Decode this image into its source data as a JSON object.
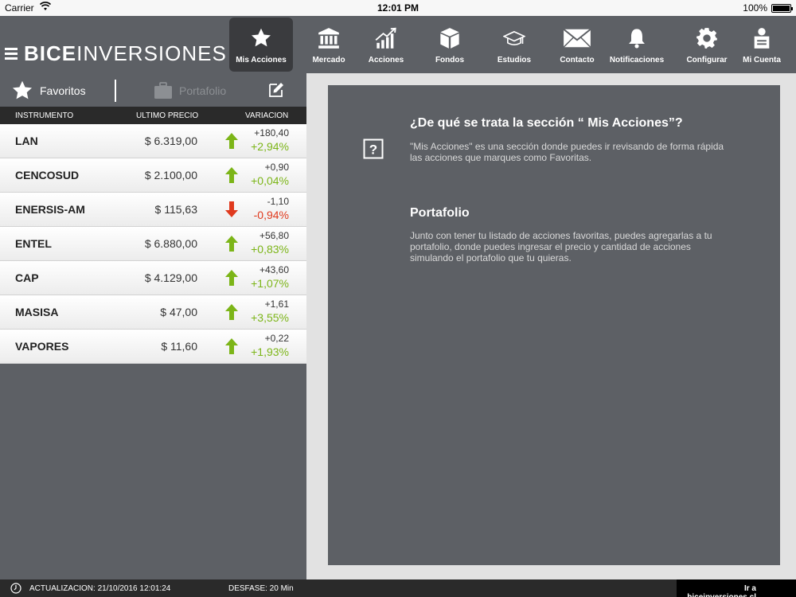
{
  "status": {
    "carrier": "Carrier",
    "time": "12:01 PM",
    "battery": "100%"
  },
  "logo": {
    "part1": "BICE",
    "part2": "INVERSIONES"
  },
  "nav": [
    {
      "label": "Mis Acciones",
      "icon": "star-icon",
      "active": true
    },
    {
      "label": "Mercado",
      "icon": "bank-icon"
    },
    {
      "label": "Acciones",
      "icon": "chart-icon"
    },
    {
      "label": "Fondos",
      "icon": "box-icon"
    },
    {
      "label": "Estudios",
      "icon": "graduation-cap-icon"
    },
    {
      "label": "Contacto",
      "icon": "envelope-icon"
    },
    {
      "label": "Notificaciones",
      "icon": "bell-icon"
    },
    {
      "label": "Configurar",
      "icon": "gear-icon"
    },
    {
      "label": "Mi Cuenta",
      "icon": "user-icon"
    }
  ],
  "tabs": {
    "favoritos": "Favoritos",
    "portafolio": "Portafolio"
  },
  "table": {
    "headers": {
      "instrument": "INSTRUMENTO",
      "price": "ULTIMO PRECIO",
      "variation": "VARIACION"
    },
    "rows": [
      {
        "name": "LAN",
        "price": "$ 6.319,00",
        "abs": "+180,40",
        "pct": "+2,94%",
        "dir": "up"
      },
      {
        "name": "CENCOSUD",
        "price": "$ 2.100,00",
        "abs": "+0,90",
        "pct": "+0,04%",
        "dir": "up"
      },
      {
        "name": "ENERSIS-AM",
        "price": "$ 115,63",
        "abs": "-1,10",
        "pct": "-0,94%",
        "dir": "down"
      },
      {
        "name": "ENTEL",
        "price": "$ 6.880,00",
        "abs": "+56,80",
        "pct": "+0,83%",
        "dir": "up"
      },
      {
        "name": "CAP",
        "price": "$ 4.129,00",
        "abs": "+43,60",
        "pct": "+1,07%",
        "dir": "up"
      },
      {
        "name": "MASISA",
        "price": "$ 47,00",
        "abs": "+1,61",
        "pct": "+3,55%",
        "dir": "up"
      },
      {
        "name": "VAPORES",
        "price": "$ 11,60",
        "abs": "+0,22",
        "pct": "+1,93%",
        "dir": "up"
      }
    ]
  },
  "help": {
    "title1": "¿De qué se trata la sección “ Mis Acciones”?",
    "body1": "\"Mis Acciones\" es una sección donde puedes ir revisando de forma rápida las acciones que marques como Favoritas.",
    "title2": "Portafolio",
    "body2": "Junto con tener tu listado de acciones favoritas, puedes agregarlas a tu portafolio, donde puedes ingresar el precio y cantidad de acciones simulando el portafolio que tu quieras."
  },
  "footer": {
    "update": "ACTUALIZACION:  21/10/2016 12:01:24",
    "desfase": "DESFASE: 20 Min",
    "link": "Ir a biceinversiones.cl"
  },
  "colors": {
    "header": "#5d6065",
    "active_nav": "#3a3b3e",
    "up": "#7cb518",
    "down": "#e03a1e"
  }
}
